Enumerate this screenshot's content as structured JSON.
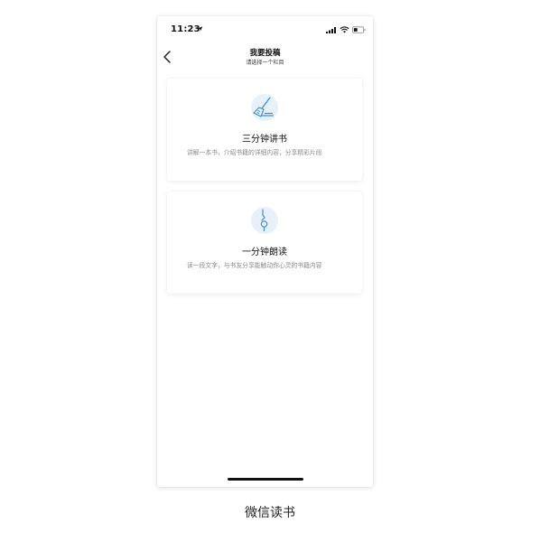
{
  "status_bar": {
    "time": "11:23"
  },
  "nav": {
    "title": "我要投稿",
    "subtitle": "请选择一个栏目"
  },
  "cards": [
    {
      "title": "三分钟讲书",
      "description": "讲解一本书，介绍书籍的详细内容，分享精彩片段",
      "icon": "broom-icon"
    },
    {
      "title": "一分钟朗读",
      "description": "读一段文字，与书友分享能触动你心灵的书籍内容",
      "icon": "microphone-icon"
    }
  ],
  "caption": "微信读书",
  "colors": {
    "accent": "#3d8fd6",
    "icon_bg": "#e8f1fa",
    "card_text": "#8a8a8a"
  }
}
